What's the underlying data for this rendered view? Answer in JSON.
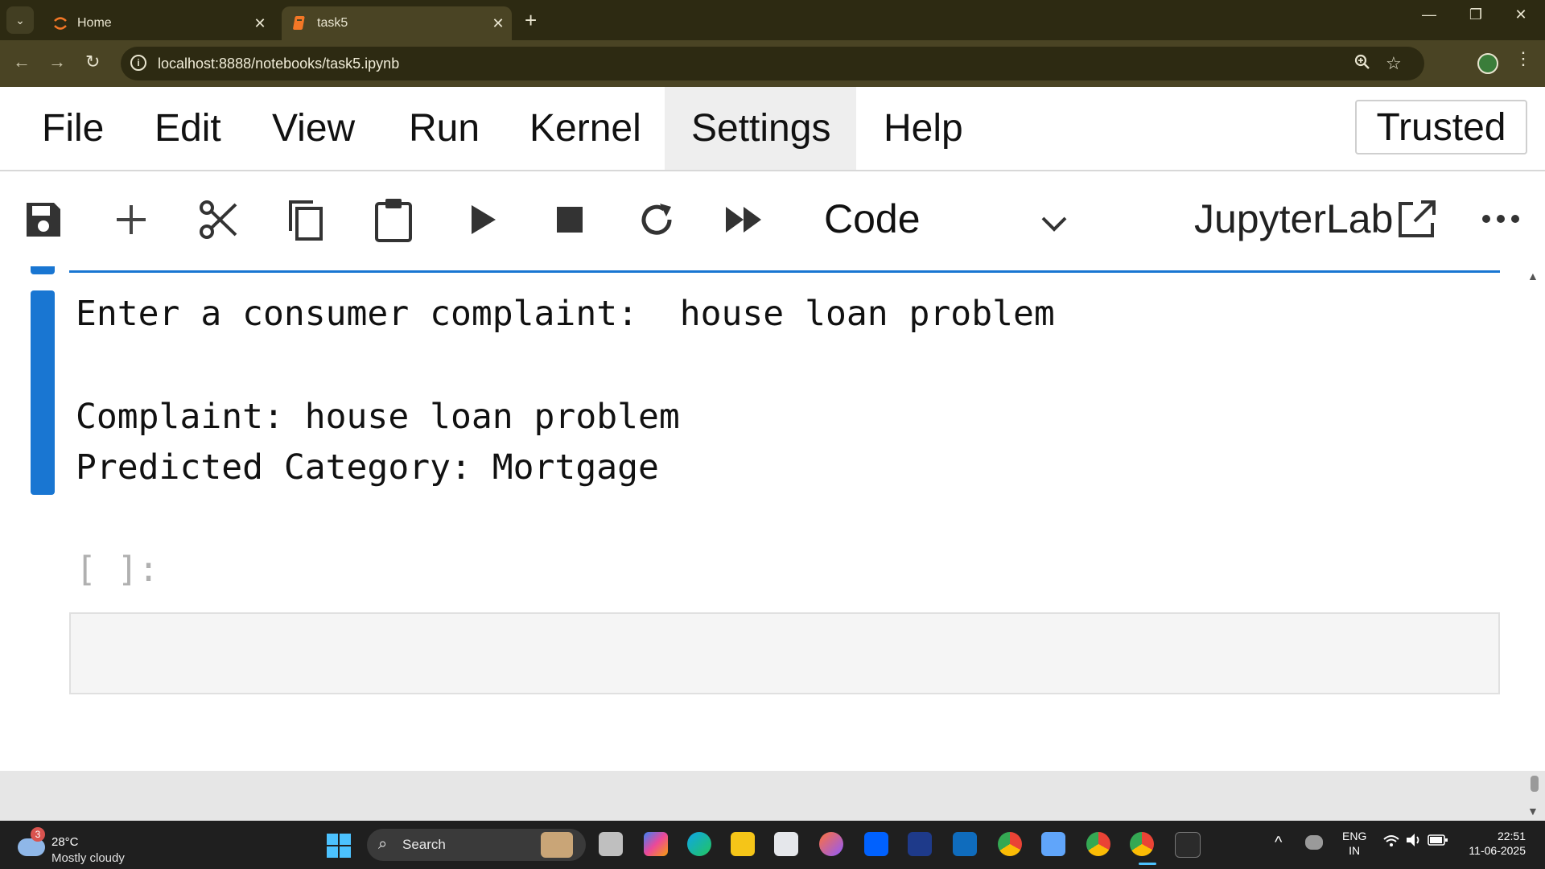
{
  "browser": {
    "tabs": [
      {
        "title": "Home",
        "icon": "jupyter-icon"
      },
      {
        "title": "task5",
        "icon": "notebook-icon"
      }
    ],
    "url": "localhost:8888/notebooks/task5.ipynb"
  },
  "menubar": {
    "items": [
      "File",
      "Edit",
      "View",
      "Run",
      "Kernel",
      "Settings",
      "Help"
    ],
    "trusted_label": "Trusted"
  },
  "toolbar": {
    "cell_type": "Code",
    "open_in_label": "JupyterLab"
  },
  "notebook": {
    "output_lines": [
      "Enter a consumer complaint:  house loan problem",
      "Complaint: house loan problem",
      "Predicted Category: Mortgage"
    ],
    "next_prompt": "[ ]:"
  },
  "taskbar": {
    "weather_temp": "28°C",
    "weather_condition": "Mostly cloudy",
    "weather_badge": "3",
    "search_label": "Search",
    "lang_primary": "ENG",
    "lang_secondary": "IN",
    "time": "22:51",
    "date": "11-06-2025"
  }
}
